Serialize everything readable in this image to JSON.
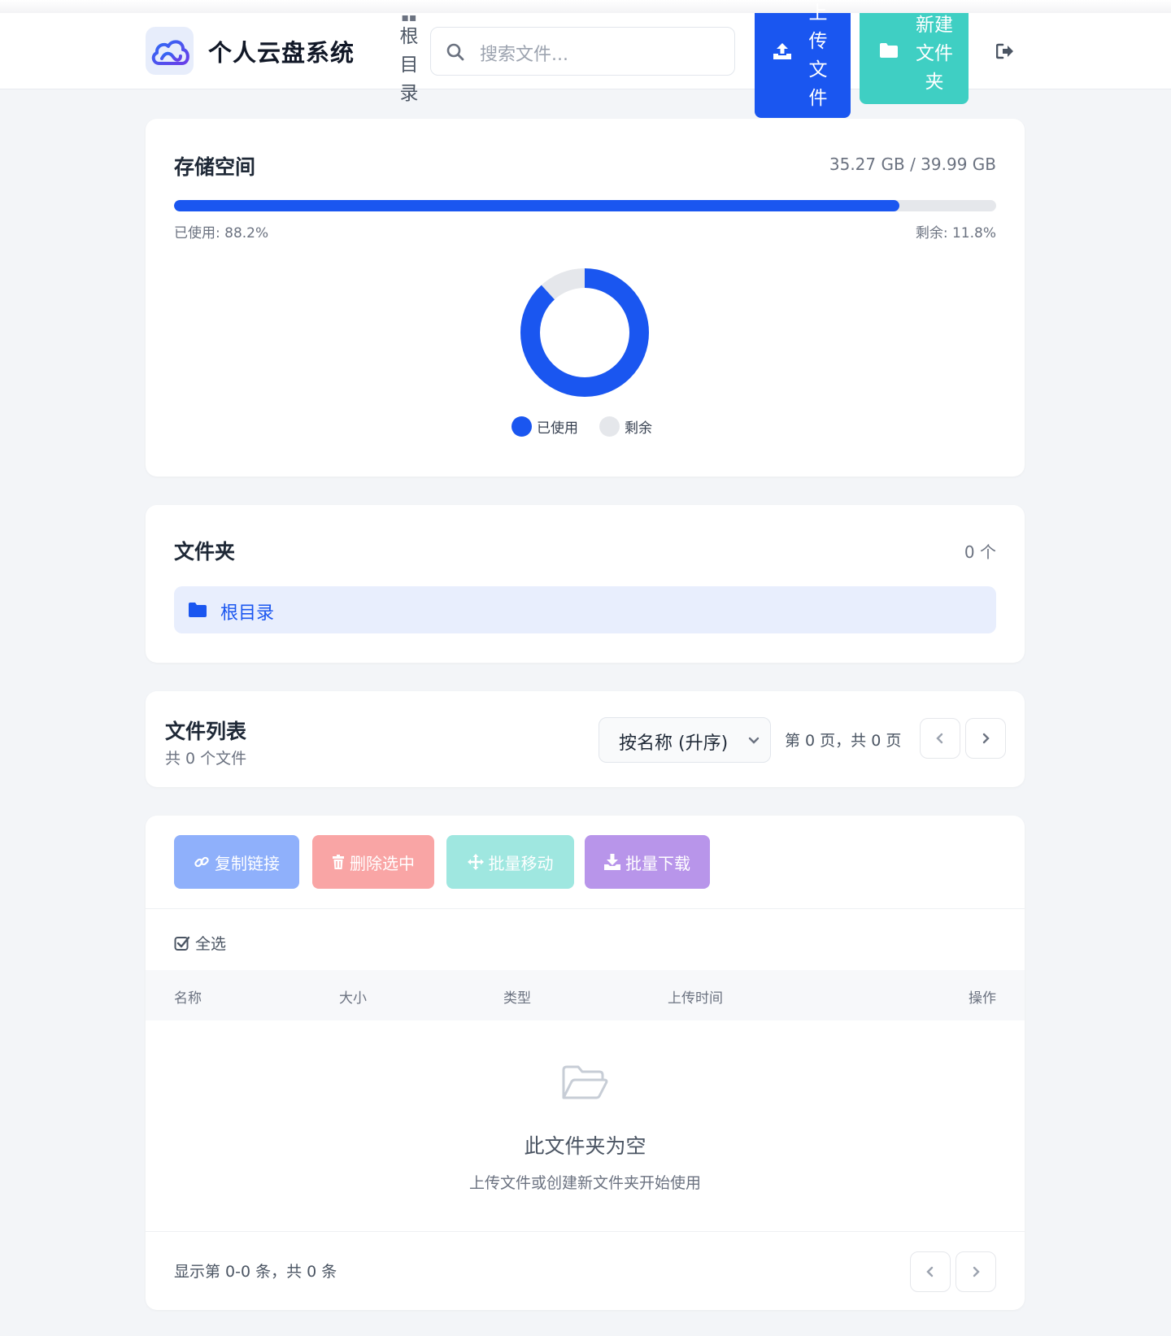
{
  "header": {
    "brand": "个人云盘系统",
    "crumb_text": "根目录",
    "search_placeholder": "搜索文件...",
    "upload_label": "上传文件",
    "new_folder_label": "新建文件夹"
  },
  "storage": {
    "title": "存储空间",
    "amount": "35.27 GB / 39.99 GB",
    "used_fraction": 0.882,
    "used_text": "已使用: 88.2%",
    "free_text": "剩余: 11.8%",
    "legend_used": "已使用",
    "legend_free": "剩余",
    "color_used": "#1a56f0",
    "color_free": "#e5e7eb"
  },
  "folders": {
    "title": "文件夹",
    "count": "0 个",
    "root_label": "根目录"
  },
  "file_list": {
    "title": "文件列表",
    "subtitle": "共 0 个文件",
    "sort_value": "按名称 (升序)",
    "page_info": "第 0 页，共 0 页"
  },
  "actions": {
    "copy_link": "复制链接",
    "delete_selected": "删除选中",
    "batch_move": "批量移动",
    "batch_download": "批量下载"
  },
  "table": {
    "select_all": "全选",
    "columns": [
      "名称",
      "大小",
      "类型",
      "上传时间",
      "操作"
    ],
    "empty_title": "此文件夹为空",
    "empty_sub": "上传文件或创建新文件夹开始使用",
    "footer": "显示第 0-0 条，共 0 条"
  },
  "colors": {
    "primary": "#1a56f0",
    "teal": "#3fcfc3",
    "copy_btn": "#8fb0fb",
    "delete_btn": "#f9a5a5",
    "move_btn": "#9fe7e0",
    "download_btn": "#b895ea"
  }
}
